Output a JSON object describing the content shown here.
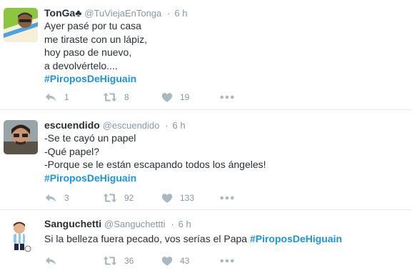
{
  "tweets": [
    {
      "name": "TonGa♣",
      "handle": "@TuViejaEnTonga",
      "separator": "·",
      "time": "6 h",
      "lines": [
        "Ayer pasé por tu casa",
        "me tiraste con un lápiz,",
        "hoy paso de nuevo,",
        "a devolvértelo...."
      ],
      "hashtag": "#PiroposDeHiguain",
      "replies": "1",
      "retweets": "8",
      "likes": "19"
    },
    {
      "name": "escuendido",
      "handle": "@escuendido",
      "separator": "·",
      "time": "6 h",
      "lines": [
        "-Se te cayó un papel",
        "-Qué papel?",
        "-Porque se le están escapando todos los ángeles!"
      ],
      "hashtag": "#PiroposDeHiguain",
      "replies": "3",
      "retweets": "92",
      "likes": "133"
    },
    {
      "name": "Sanguchetti",
      "handle": "@Sanguchettti",
      "separator": "·",
      "time": "6 h",
      "text": "Si la belleza fuera pecado, vos serías el Papa",
      "hashtag": "#PiroposDeHiguain",
      "replies": "",
      "retweets": "36",
      "likes": "43"
    }
  ],
  "icons": {
    "reply": "reply-icon",
    "retweet": "retweet-icon",
    "like": "heart-icon",
    "more": "more-icon"
  },
  "colors": {
    "hashtag": "#1b95e0",
    "muted": "#8899a6",
    "icon": "#aab8c2",
    "text": "#292f33",
    "divider": "#e1e8ed"
  }
}
